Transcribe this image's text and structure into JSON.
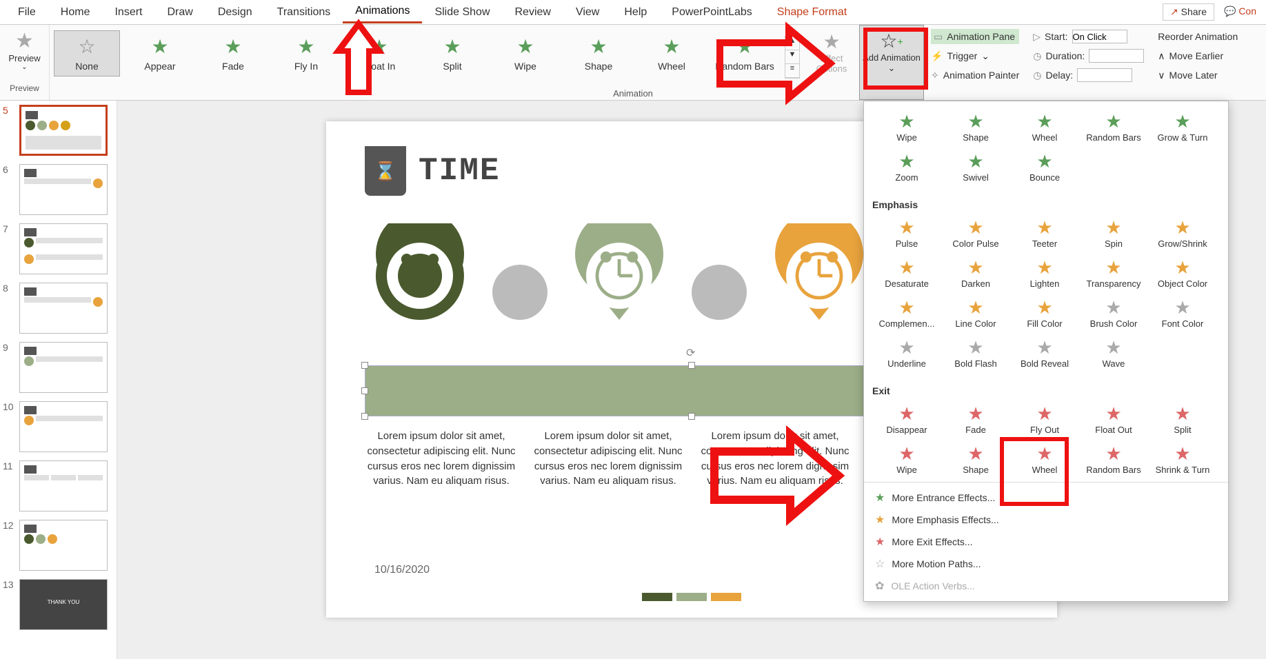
{
  "ribbon_tabs": {
    "file": "File",
    "home": "Home",
    "insert": "Insert",
    "draw": "Draw",
    "design": "Design",
    "transitions": "Transitions",
    "animations": "Animations",
    "slideshow": "Slide Show",
    "review": "Review",
    "view": "View",
    "help": "Help",
    "pptlabs": "PowerPointLabs",
    "shape_format": "Shape Format",
    "share": "Share",
    "comments": "Con"
  },
  "preview": {
    "label": "Preview",
    "group": "Preview"
  },
  "gallery": {
    "none": "None",
    "appear": "Appear",
    "fade": "Fade",
    "flyin": "Fly In",
    "floatin": "Float In",
    "split": "Split",
    "wipe": "Wipe",
    "shape": "Shape",
    "wheel": "Wheel",
    "random_bars": "Random Bars",
    "group_label": "Animation"
  },
  "effect_options": "Effect Options",
  "add_animation": "Add Animation",
  "advanced": {
    "animation_pane": "Animation Pane",
    "trigger": "Trigger",
    "animation_painter": "Animation Painter",
    "start": "Start:",
    "start_value": "On Click",
    "duration": "Duration:",
    "delay": "Delay:",
    "reorder": "Reorder Animation",
    "move_earlier": "Move Earlier",
    "move_later": "Move Later"
  },
  "thumbs": [
    5,
    6,
    7,
    8,
    9,
    10,
    11,
    12,
    13
  ],
  "slide": {
    "title": "TIME",
    "lorem": "Lorem ipsum dolor sit amet, consectetur adipiscing elit. Nunc cursus eros nec lorem dignissim varius. Nam eu aliquam risus.",
    "date": "10/16/2020"
  },
  "dropdown": {
    "entrance_extra": [
      "Wipe",
      "Shape",
      "Wheel",
      "Random Bars",
      "Grow & Turn",
      "Zoom",
      "Swivel",
      "Bounce"
    ],
    "emphasis_header": "Emphasis",
    "emphasis": [
      "Pulse",
      "Color Pulse",
      "Teeter",
      "Spin",
      "Grow/Shrink",
      "Desaturate",
      "Darken",
      "Lighten",
      "Transparency",
      "Object Color",
      "Complemen...",
      "Line Color",
      "Fill Color",
      "Brush Color",
      "Font Color",
      "Underline",
      "Bold Flash",
      "Bold Reveal",
      "Wave"
    ],
    "exit_header": "Exit",
    "exit": [
      "Disappear",
      "Fade",
      "Fly Out",
      "Float Out",
      "Split",
      "Wipe",
      "Shape",
      "Wheel",
      "Random Bars",
      "Shrink & Turn"
    ],
    "footer": {
      "entrance": "More Entrance Effects...",
      "emphasis": "More Emphasis Effects...",
      "exit": "More Exit Effects...",
      "motion": "More Motion Paths...",
      "ole": "OLE Action Verbs..."
    }
  }
}
